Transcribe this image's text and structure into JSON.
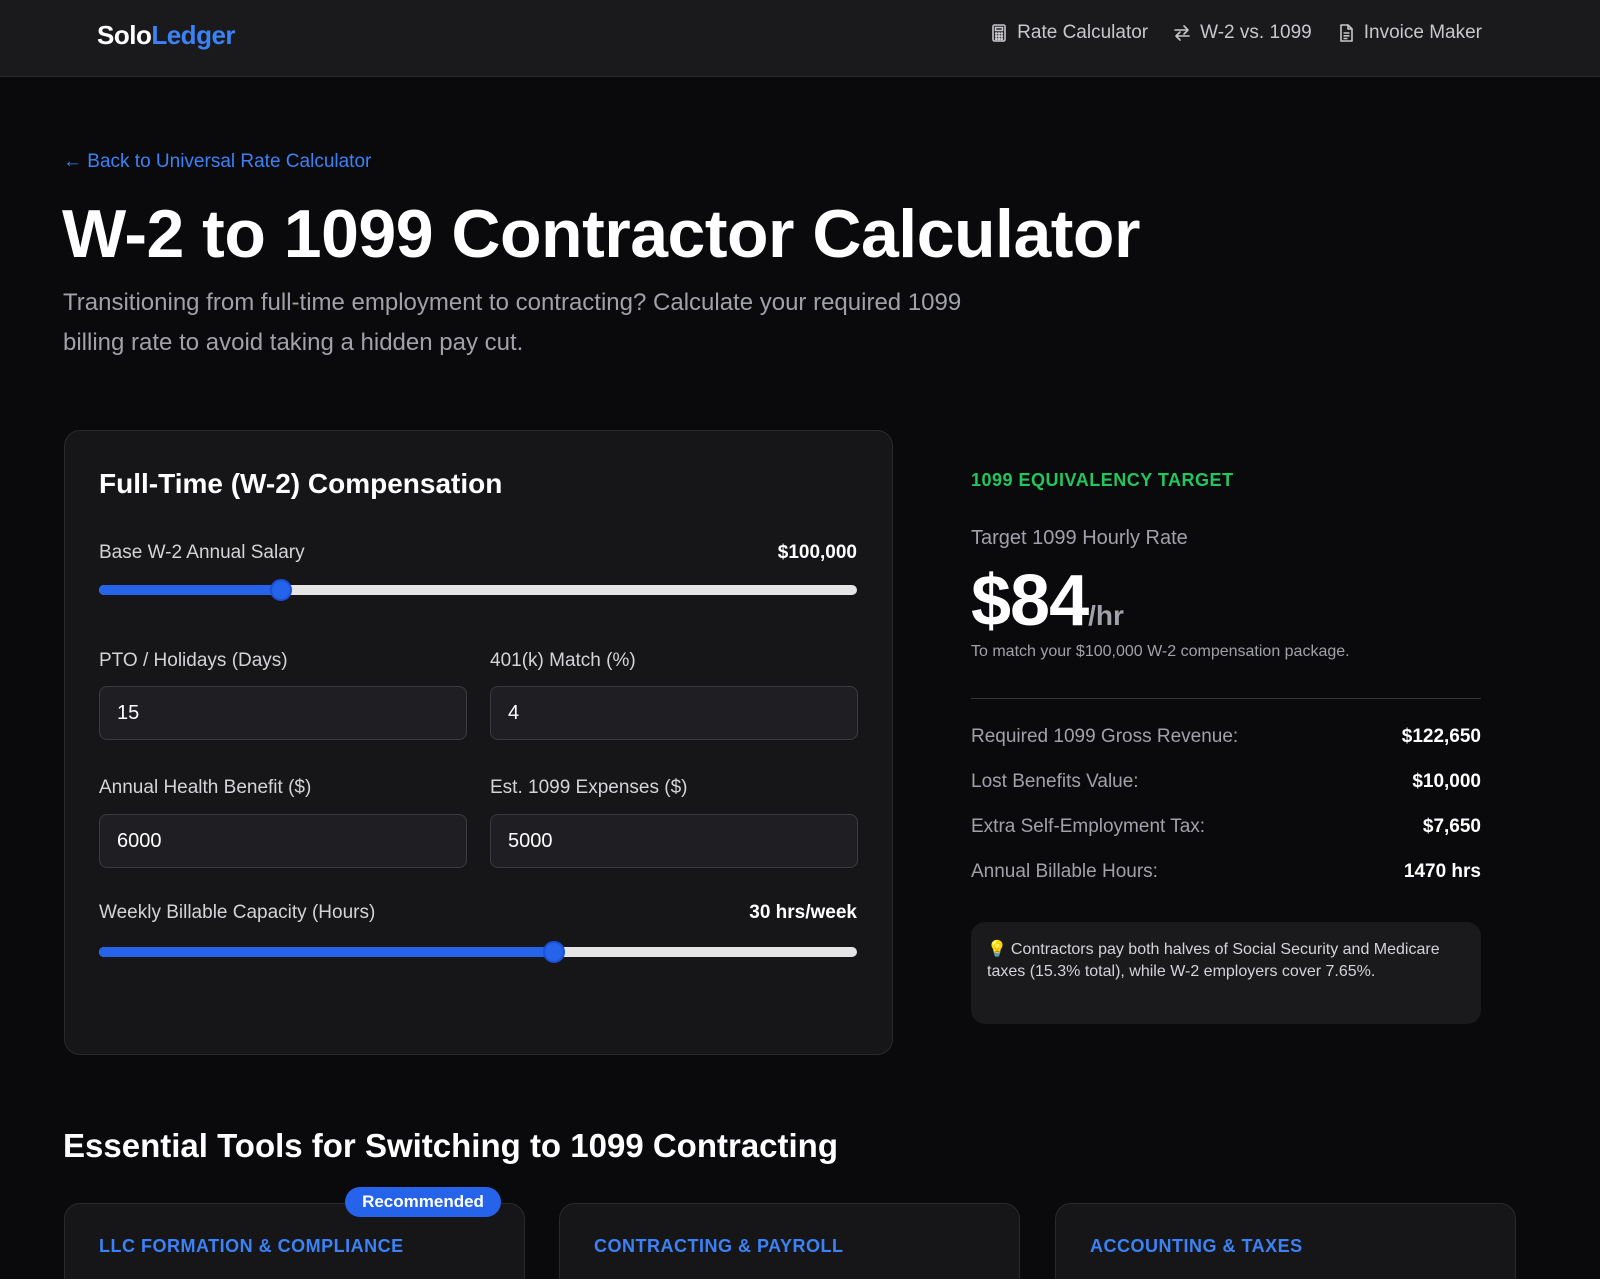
{
  "brand": {
    "part1": "Solo",
    "part2": "Ledger",
    "accent": "#3b82f6"
  },
  "nav": [
    {
      "label": "Rate Calculator",
      "icon": "calculator-icon"
    },
    {
      "label": "W-2 vs. 1099",
      "icon": "swap-icon"
    },
    {
      "label": "Invoice Maker",
      "icon": "document-icon"
    }
  ],
  "back_link": "← Back to Universal Rate Calculator",
  "title": "W-2 to 1099 Contractor Calculator",
  "subtitle": "Transitioning from full-time employment to contracting? Calculate your required 1099 billing rate to avoid taking a hidden pay cut.",
  "form": {
    "title": "Full-Time (W-2) Compensation",
    "salary": {
      "label": "Base W-2 Annual Salary",
      "display": "$100,000",
      "fill_fraction": 0.24
    },
    "pto": {
      "label": "PTO / Holidays (Days)",
      "value": "15"
    },
    "match": {
      "label": "401(k) Match (%)",
      "value": "4"
    },
    "health": {
      "label": "Annual Health Benefit ($)",
      "value": "6000"
    },
    "expenses": {
      "label": "Est. 1099 Expenses ($)",
      "value": "5000"
    },
    "capacity": {
      "label": "Weekly Billable Capacity (Hours)",
      "display": "30 hrs/week",
      "fill_fraction": 0.6
    }
  },
  "results": {
    "eyebrow": "1099 EQUIVALENCY TARGET",
    "rate_label": "Target 1099 Hourly Rate",
    "rate_value": "$84",
    "rate_unit": "/hr",
    "rate_note": "To match your $100,000 W-2 compensation package.",
    "rows": [
      {
        "label": "Required 1099 Gross Revenue:",
        "value": "$122,650"
      },
      {
        "label": "Lost Benefits Value:",
        "value": "$10,000"
      },
      {
        "label": "Extra Self-Employment Tax:",
        "value": "$7,650"
      },
      {
        "label": "Annual Billable Hours:",
        "value": "1470 hrs"
      }
    ],
    "tip_icon": "lightbulb-icon",
    "tip": "Contractors pay both halves of Social Security and Medicare taxes (15.3% total), while W-2 employers cover 7.65%."
  },
  "tools": {
    "title": "Essential Tools for Switching to 1099 Contracting",
    "badge": "Recommended",
    "cards": [
      {
        "category": "LLC FORMATION & COMPLIANCE"
      },
      {
        "category": "CONTRACTING & PAYROLL"
      },
      {
        "category": "ACCOUNTING & TAXES"
      }
    ]
  },
  "colors": {
    "background": "#0a0a0c",
    "accent": "#3b82f6",
    "slider": "#2563eb",
    "success": "#22c55e"
  }
}
